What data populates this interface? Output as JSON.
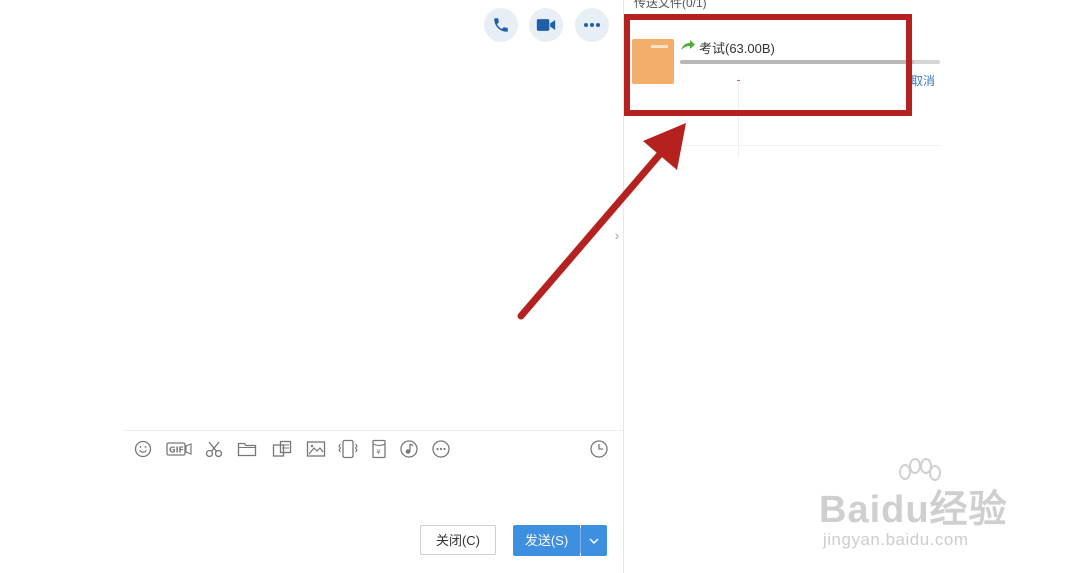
{
  "header": {
    "icons": [
      "phone-icon",
      "video-call-icon",
      "more-options-icon"
    ],
    "accent_color": "#1f5fa8"
  },
  "right_panel": {
    "title": "传送文件(0/1)",
    "file": {
      "name": "考试(63.00B)",
      "progress": 0.9,
      "cancel_label": "取消",
      "icon": "folder-icon"
    }
  },
  "toolbar": {
    "icons": [
      "emoji-icon",
      "gif-icon",
      "scissors-icon",
      "folder-icon",
      "screenshot-icon",
      "image-icon",
      "shake-icon",
      "red-packet-icon",
      "music-icon",
      "more-icon",
      "history-clock-icon"
    ]
  },
  "buttons": {
    "close_label": "关闭(C)",
    "send_label": "发送(S)"
  },
  "annotation": {
    "color": "#b5211e"
  },
  "watermark": {
    "brand": "Baidu经验",
    "url": "jingyan.baidu.com"
  }
}
